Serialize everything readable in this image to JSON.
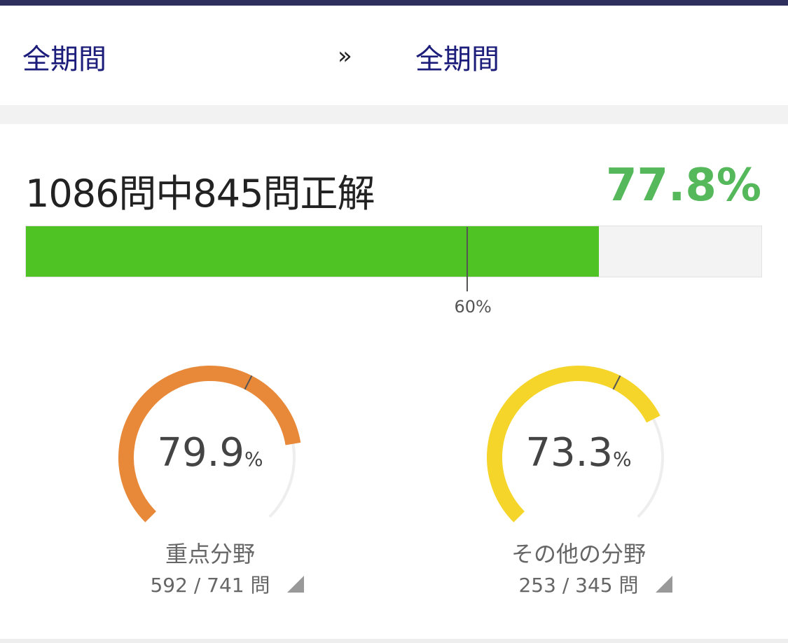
{
  "header": {
    "period_from": "全期間",
    "separator": "»",
    "period_to": "全期間"
  },
  "summary": {
    "text": "1086問中845問正解",
    "total": 1086,
    "correct": 845,
    "percent_label": "77.8%",
    "percent": 77.8,
    "pass_mark": 60,
    "pass_mark_label": "60%"
  },
  "gauges": [
    {
      "percent": 79.9,
      "percent_label": "79.9",
      "unit": "%",
      "name": "重点分野",
      "count": "592 / 741 問",
      "color": "#e8893a",
      "expand_icon": "triangle-icon"
    },
    {
      "percent": 73.3,
      "percent_label": "73.3",
      "unit": "%",
      "name": "その他の分野",
      "count": "253 / 345 問",
      "color": "#f5d52a",
      "expand_icon": "triangle-icon"
    }
  ],
  "colors": {
    "accent_green": "#55b85a",
    "bar_fill": "#50c324",
    "link_blue": "#1c1c7a"
  }
}
